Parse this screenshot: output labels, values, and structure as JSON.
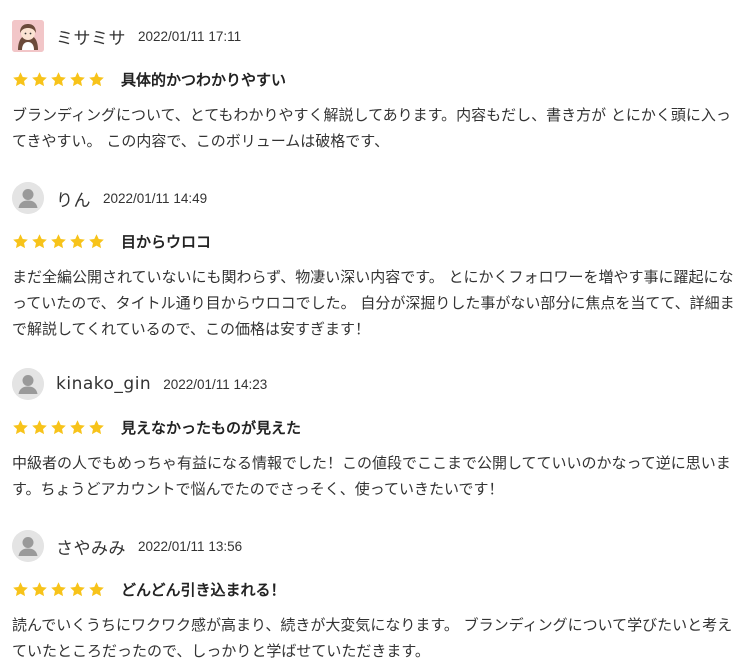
{
  "reviews": [
    {
      "reviewer": "ミサミサ",
      "date": "2022/01/11 17:11",
      "avatar": "photo-avatar",
      "stars": 5,
      "title": "具体的かつわかりやすい",
      "body": "ブランディングについて、とてもわかりやすく解説してあります。内容もだし、書き方が とにかく頭に入ってきやすい。 この内容で、このボリュームは破格です、"
    },
    {
      "reviewer": "りん",
      "date": "2022/01/11 14:49",
      "avatar": "default-user-icon",
      "stars": 5,
      "title": "目からウロコ",
      "body": "まだ全編公開されていないにも関わらず、物凄い深い内容です。 とにかくフォロワーを増やす事に躍起になっていたので、タイトル通り目からウロコでした。 自分が深掘りした事がない部分に焦点を当てて、詳細まで解説してくれているので、この価格は安すぎます！"
    },
    {
      "reviewer": "kinako_gin",
      "date": "2022/01/11 14:23",
      "avatar": "default-user-icon",
      "stars": 5,
      "title": "見えなかったものが見えた",
      "body": "中級者の人でもめっちゃ有益になる情報でした！この値段でここまで公開してていいのかなって逆に思います。ちょうどアカウントで悩んでたのでさっそく、使っていきたいです！"
    },
    {
      "reviewer": "さやみみ",
      "date": "2022/01/11 13:56",
      "avatar": "default-user-icon",
      "stars": 5,
      "title": "どんどん引き込まれる！",
      "body": "読んでいくうちにワクワク感が高まり、続きが大変気になります。 ブランディングについて学びたいと考えていたところだったので、しっかりと学ばせていただきます。"
    }
  ],
  "colors": {
    "star": "#f7c31a",
    "text": "#333333",
    "avatar_bg": "#e4e4e4",
    "avatar_fg": "#9a9a9a"
  }
}
